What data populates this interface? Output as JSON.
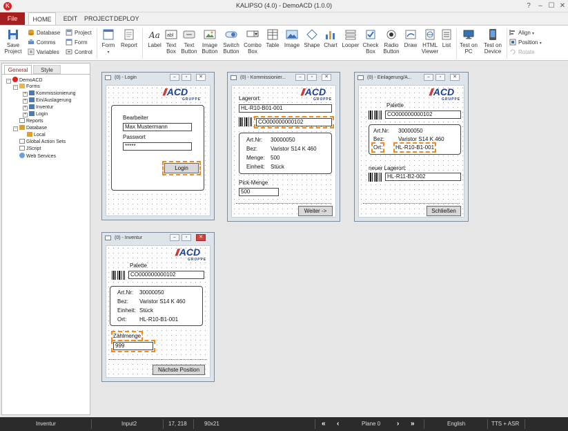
{
  "window": {
    "title": "KALIPSO (4.0)  -  DemoACD (1.0.0)",
    "logo": "K",
    "controls": [
      "?",
      "–",
      "☐",
      "✕"
    ]
  },
  "tabs": {
    "file": "File",
    "home": "HOME",
    "edit": "EDIT",
    "project": "PROJECT",
    "deploy": "DEPLOY"
  },
  "ribbon": {
    "save_project": [
      "Save",
      "Project"
    ],
    "database": "Database",
    "comms": "Comms",
    "variables": "Variables",
    "project": "Project",
    "form": "Form",
    "control": "Control",
    "form_big": "Form",
    "report": "Report",
    "label": "Label",
    "textbox": [
      "Text",
      "Box"
    ],
    "textbutton": [
      "Text",
      "Button"
    ],
    "imagebutton": [
      "Image",
      "Button"
    ],
    "switchbutton": [
      "Switch",
      "Button"
    ],
    "combobox": [
      "Combo",
      "Box"
    ],
    "table": "Table",
    "image": "Image",
    "shape": "Shape",
    "chart": "Chart",
    "looper": "Looper",
    "checkbox": [
      "Check",
      "Box"
    ],
    "radiobutton": [
      "Radio",
      "Button"
    ],
    "draw": "Draw",
    "htmlviewer": [
      "HTML",
      "Viewer"
    ],
    "list": "List",
    "testonpc": [
      "Test on",
      "PC"
    ],
    "testondevice": [
      "Test on",
      "Device"
    ],
    "align": "Align",
    "position": "Position",
    "rotate": "Rotate"
  },
  "left_panel": {
    "tabs": {
      "general": "General",
      "style": "Style"
    },
    "tree": {
      "root": "DemoACD",
      "forms": "Forms",
      "kommissionierung": "Kommissionierung",
      "einauslagerung": "Ein/Auslagerung",
      "inventur": "Inventur",
      "login": "Login",
      "reports": "Reports",
      "database": "Database",
      "local": "Local",
      "global_action_sets": "Global Action Sets",
      "jscript": "JScript",
      "web_services": "Web Services"
    }
  },
  "logo": {
    "brand": "ACD",
    "sub": "GRUPPE"
  },
  "forms": {
    "login": {
      "title": "(0) - Login",
      "bearbeiter_label": "Bearbeiter",
      "bearbeiter_value": "Max Mustermann",
      "passwort_label": "Passwort",
      "passwort_value": "*****",
      "login_button": "Login"
    },
    "kommissionierung": {
      "title": "(0) - Kommissionier...",
      "lagerort_label": "Lagerort:",
      "lagerort_value": "HL-R10-B01-001",
      "barcode_value": "CO000000000102",
      "artnr_label": "Art.Nr:",
      "artnr_value": "30000050",
      "bez_label": "Bez:",
      "bez_value": "Varistor S14 K 460",
      "menge_label": "Menge:",
      "menge_value": "500",
      "einheit_label": "Einheit:",
      "einheit_value": "Stück",
      "pickmenge_label": "Pick-Menge",
      "pickmenge_value": "500",
      "weiter_button": "Weiter ->"
    },
    "einlagerung": {
      "title": "(0) - Einlagerung/A...",
      "palette_label": "Palette",
      "palette_value": "CO000000000102",
      "artnr_label": "Art.Nr:",
      "artnr_value": "30000050",
      "bez_label": "Bez:",
      "bez_value": "Varistor S14 K 460",
      "ort_label": "Ort:",
      "ort_value": "HL-R10-B1-001",
      "neuer_lagerort_label": "neuer Lagerort:",
      "neuer_lagerort_value": "HL-R11-B2-002",
      "schliessen_button": "Schließen"
    },
    "inventur": {
      "title": "(0) - Inventur",
      "palette_label": "Palette",
      "palette_value": "CO000000000102",
      "artnr_label": "Art.Nr:",
      "artnr_value": "30000050",
      "bez_label": "Bez:",
      "bez_value": "Varistor S14 K 460",
      "einheit_label": "Einheit:",
      "einheit_value": "Stück",
      "ort_label": "Ort:",
      "ort_value": "HL-R10-B1-001",
      "zaehlmenge_label": "Zählmenge",
      "zaehlmenge_value": "999",
      "naechste_button": "Nächste Position"
    }
  },
  "statusbar": {
    "form": "Inventur",
    "control": "Input2",
    "position": "17, 218",
    "size": "90x21",
    "plane": "Plane 0",
    "language": "English",
    "tts": "TTS + ASR"
  },
  "colors": {
    "accent": "#a51f1f",
    "selection": "#f08a1c",
    "brand_blue": "#1b3f95",
    "brand_red": "#c8231e"
  }
}
